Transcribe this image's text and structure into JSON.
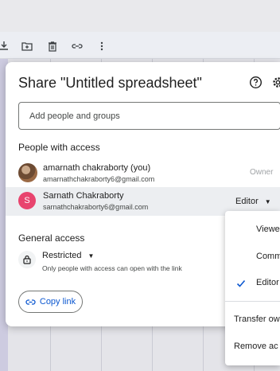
{
  "dialog": {
    "title": "Share \"Untitled spreadsheet\"",
    "add_placeholder": "Add people and groups",
    "people_section_title": "People with access",
    "people": [
      {
        "name": "amarnath chakraborty (you)",
        "email": "amarnathchakraborty6@gmail.com",
        "role": "Owner",
        "avatar": "photo"
      },
      {
        "name": "Sarnath Chakraborty",
        "email": "sarnathchakraborty6@gmail.com",
        "role": "Editor",
        "avatar_letter": "S",
        "avatar_color": "#e8446e"
      }
    ],
    "general_access_title": "General access",
    "access_level": "Restricted",
    "access_description": "Only people with access can open with the link",
    "copy_link_label": "Copy link"
  },
  "role_menu": {
    "items": [
      {
        "label": "Viewe",
        "checked": false
      },
      {
        "label": "Comm",
        "checked": false
      },
      {
        "label": "Editor",
        "checked": true
      }
    ],
    "actions": [
      {
        "label": "Transfer ow"
      },
      {
        "label": "Remove ac"
      }
    ]
  },
  "colors": {
    "accent_blue": "#0b57d0",
    "avatar_pink": "#e8446e",
    "row_highlight": "#eceef1"
  },
  "icons": [
    "download-icon",
    "move-to-folder-icon",
    "trash-icon",
    "link-icon",
    "more-vert-icon",
    "help-icon",
    "gear-icon",
    "lock-icon",
    "check-icon",
    "chevron-down-icon"
  ]
}
